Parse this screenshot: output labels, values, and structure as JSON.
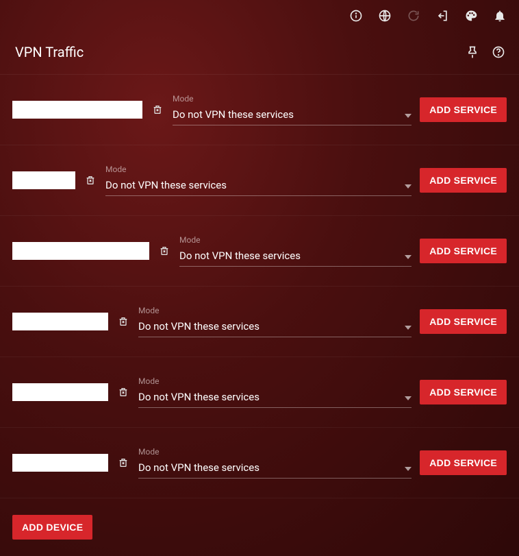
{
  "header": {
    "title": "VPN Traffic"
  },
  "labels": {
    "mode": "Mode",
    "add_service": "ADD SERVICE",
    "add_device": "ADD DEVICE"
  },
  "rows": [
    {
      "device": "",
      "mode_value": "Do not VPN these services",
      "input_width": "w190"
    },
    {
      "device": "",
      "mode_value": "Do not VPN these services",
      "input_width": "w92"
    },
    {
      "device": "",
      "mode_value": "Do not VPN these services",
      "input_width": "w200"
    },
    {
      "device": "",
      "mode_value": "Do not VPN these services",
      "input_width": "w140"
    },
    {
      "device": "",
      "mode_value": "Do not VPN these services",
      "input_width": "w140"
    },
    {
      "device": "",
      "mode_value": "Do not VPN these services",
      "input_width": "w140"
    }
  ]
}
